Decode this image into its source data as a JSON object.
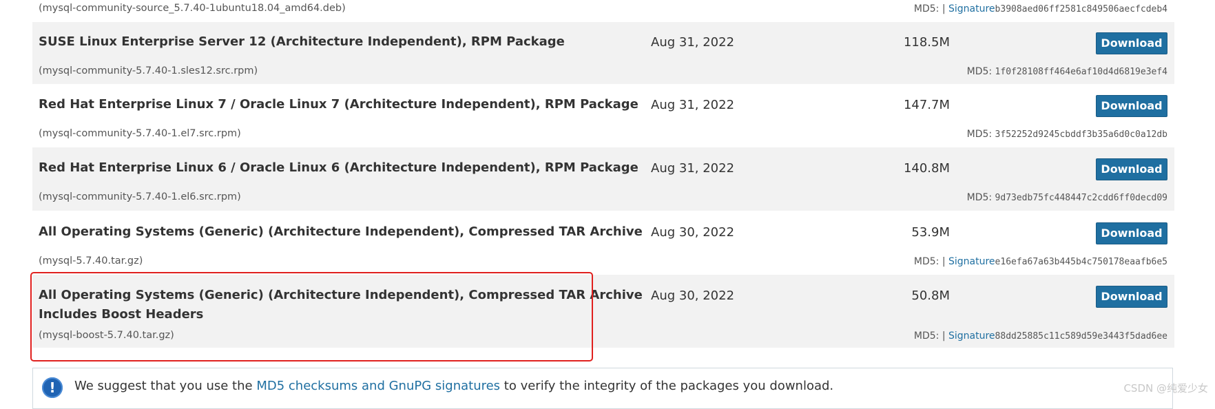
{
  "top_row": {
    "file": "(mysql-community-source_5.7.40-1ubuntu18.04_amd64.deb)",
    "md5_prefix": "MD5: |",
    "signature_label": "Signature",
    "hash": "b3908aed06ff2581c849506aecfcdeb4"
  },
  "packages": [
    {
      "title": "SUSE Linux Enterprise Server 12 (Architecture Independent), RPM Package",
      "file": "(mysql-community-5.7.40-1.sles12.src.rpm)",
      "date": "Aug 31, 2022",
      "size": "118.5M",
      "button": "Download",
      "md5_prefix": "MD5:",
      "hash": "1f0f28108ff464e6af10d4d6819e3ef4"
    },
    {
      "title": "Red Hat Enterprise Linux 7 / Oracle Linux 7 (Architecture Independent), RPM Package",
      "file": "(mysql-community-5.7.40-1.el7.src.rpm)",
      "date": "Aug 31, 2022",
      "size": "147.7M",
      "button": "Download",
      "md5_prefix": "MD5:",
      "hash": "3f52252d9245cbddf3b35a6d0c0a12db"
    },
    {
      "title": "Red Hat Enterprise Linux 6 / Oracle Linux 6 (Architecture Independent), RPM Package",
      "file": "(mysql-community-5.7.40-1.el6.src.rpm)",
      "date": "Aug 31, 2022",
      "size": "140.8M",
      "button": "Download",
      "md5_prefix": "MD5:",
      "hash": "9d73edb75fc448447c2cdd6ff0decd09"
    },
    {
      "title": "All Operating Systems (Generic) (Architecture Independent), Compressed TAR Archive",
      "file": "(mysql-5.7.40.tar.gz)",
      "date": "Aug 30, 2022",
      "size": "53.9M",
      "button": "Download",
      "md5_prefix": "MD5: |",
      "signature_label": "Signature",
      "hash": "e16efa67a63b445b4c750178eaafb6e5"
    },
    {
      "title": "All Operating Systems (Generic) (Architecture Independent), Compressed TAR Archive",
      "title_line2": "Includes Boost Headers",
      "file": "(mysql-boost-5.7.40.tar.gz)",
      "date": "Aug 30, 2022",
      "size": "50.8M",
      "button": "Download",
      "md5_prefix": "MD5: |",
      "signature_label": "Signature",
      "hash": "88dd25885c11c589d59e3443f5dad6ee"
    }
  ],
  "notice": {
    "icon": "info-icon",
    "prefix": "We suggest that you use the ",
    "link": "MD5 checksums and GnuPG signatures",
    "suffix": " to verify the integrity of the packages you download."
  },
  "watermark": "CSDN @纯爱少女",
  "colors": {
    "button": "#1f6fa1",
    "link": "#1f6fa1",
    "highlight": "#e0201e",
    "row_alt": "#f2f2f2"
  }
}
